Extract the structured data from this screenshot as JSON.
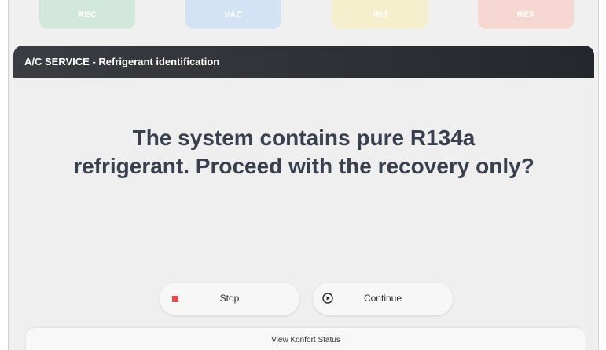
{
  "phase_tabs": [
    {
      "label": "REC",
      "color": "#d2e8dd"
    },
    {
      "label": "VAC",
      "color": "#d3e2f4"
    },
    {
      "label": "INJ",
      "color": "#f6efcd"
    },
    {
      "label": "REF",
      "color": "#f7d7d2"
    }
  ],
  "panel": {
    "title": "A/C SERVICE - Refrigerant identification",
    "message_line1": "The system contains pure R134a",
    "message_line2": "refrigerant. Proceed with the recovery only?"
  },
  "buttons": {
    "stop_label": "Stop",
    "stop_icon": "stop-square-icon",
    "stop_icon_color": "#e5484d",
    "continue_label": "Continue",
    "continue_icon": "play-circle-icon"
  },
  "status_bar": {
    "label": "View Konfort Status"
  }
}
